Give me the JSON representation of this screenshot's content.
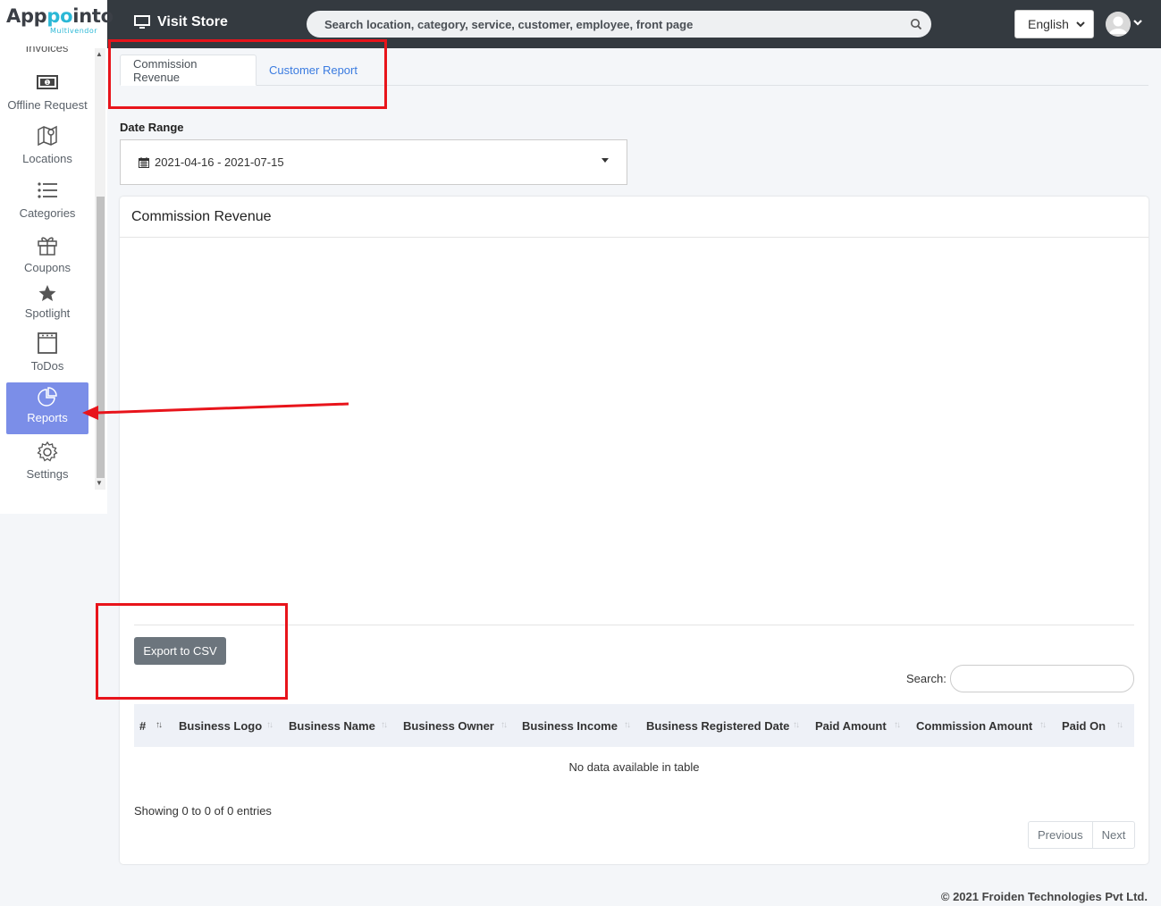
{
  "app": {
    "logo_text_a": "App",
    "logo_text_pp": "po",
    "logo_text_b": "into",
    "logo_sub": "Multivendor"
  },
  "sidebar": {
    "cut_item": "Invoices",
    "items": [
      {
        "label": "Offline Request",
        "icon": "money-icon"
      },
      {
        "label": "Locations",
        "icon": "map-icon"
      },
      {
        "label": "Categories",
        "icon": "list-icon"
      },
      {
        "label": "Coupons",
        "icon": "gift-icon"
      },
      {
        "label": "Spotlight",
        "icon": "star-icon"
      },
      {
        "label": "ToDos",
        "icon": "todo-icon"
      },
      {
        "label": "Reports",
        "icon": "pie-chart-icon",
        "active": true
      },
      {
        "label": "Settings",
        "icon": "gear-icon"
      }
    ]
  },
  "topbar": {
    "visit_store": "Visit Store",
    "search_placeholder": "Search location, category, service, customer, employee, front page",
    "language": "English"
  },
  "tabs": [
    {
      "label": "Commission Revenue",
      "active": true
    },
    {
      "label": "Customer Report",
      "active": false
    }
  ],
  "date_range": {
    "label": "Date Range",
    "value": "2021-04-16 - 2021-07-15"
  },
  "card": {
    "title": "Commission Revenue",
    "export_label": "Export to CSV",
    "search_label": "Search:",
    "columns": [
      "#",
      "Business Logo",
      "Business Name",
      "Business Owner",
      "Business Income",
      "Business Registered Date",
      "Paid Amount",
      "Commission Amount",
      "Paid On"
    ],
    "empty_text": "No data available in table",
    "showing_text": "Showing 0 to 0 of 0 entries",
    "pager": {
      "previous": "Previous",
      "next": "Next"
    }
  },
  "footer": {
    "text": "© 2021 Froiden Technologies Pvt Ltd."
  },
  "colors": {
    "active_nav": "#7b8ee8",
    "topbar": "#343a40",
    "annotation": "#e8141b",
    "link": "#3a7be0"
  }
}
